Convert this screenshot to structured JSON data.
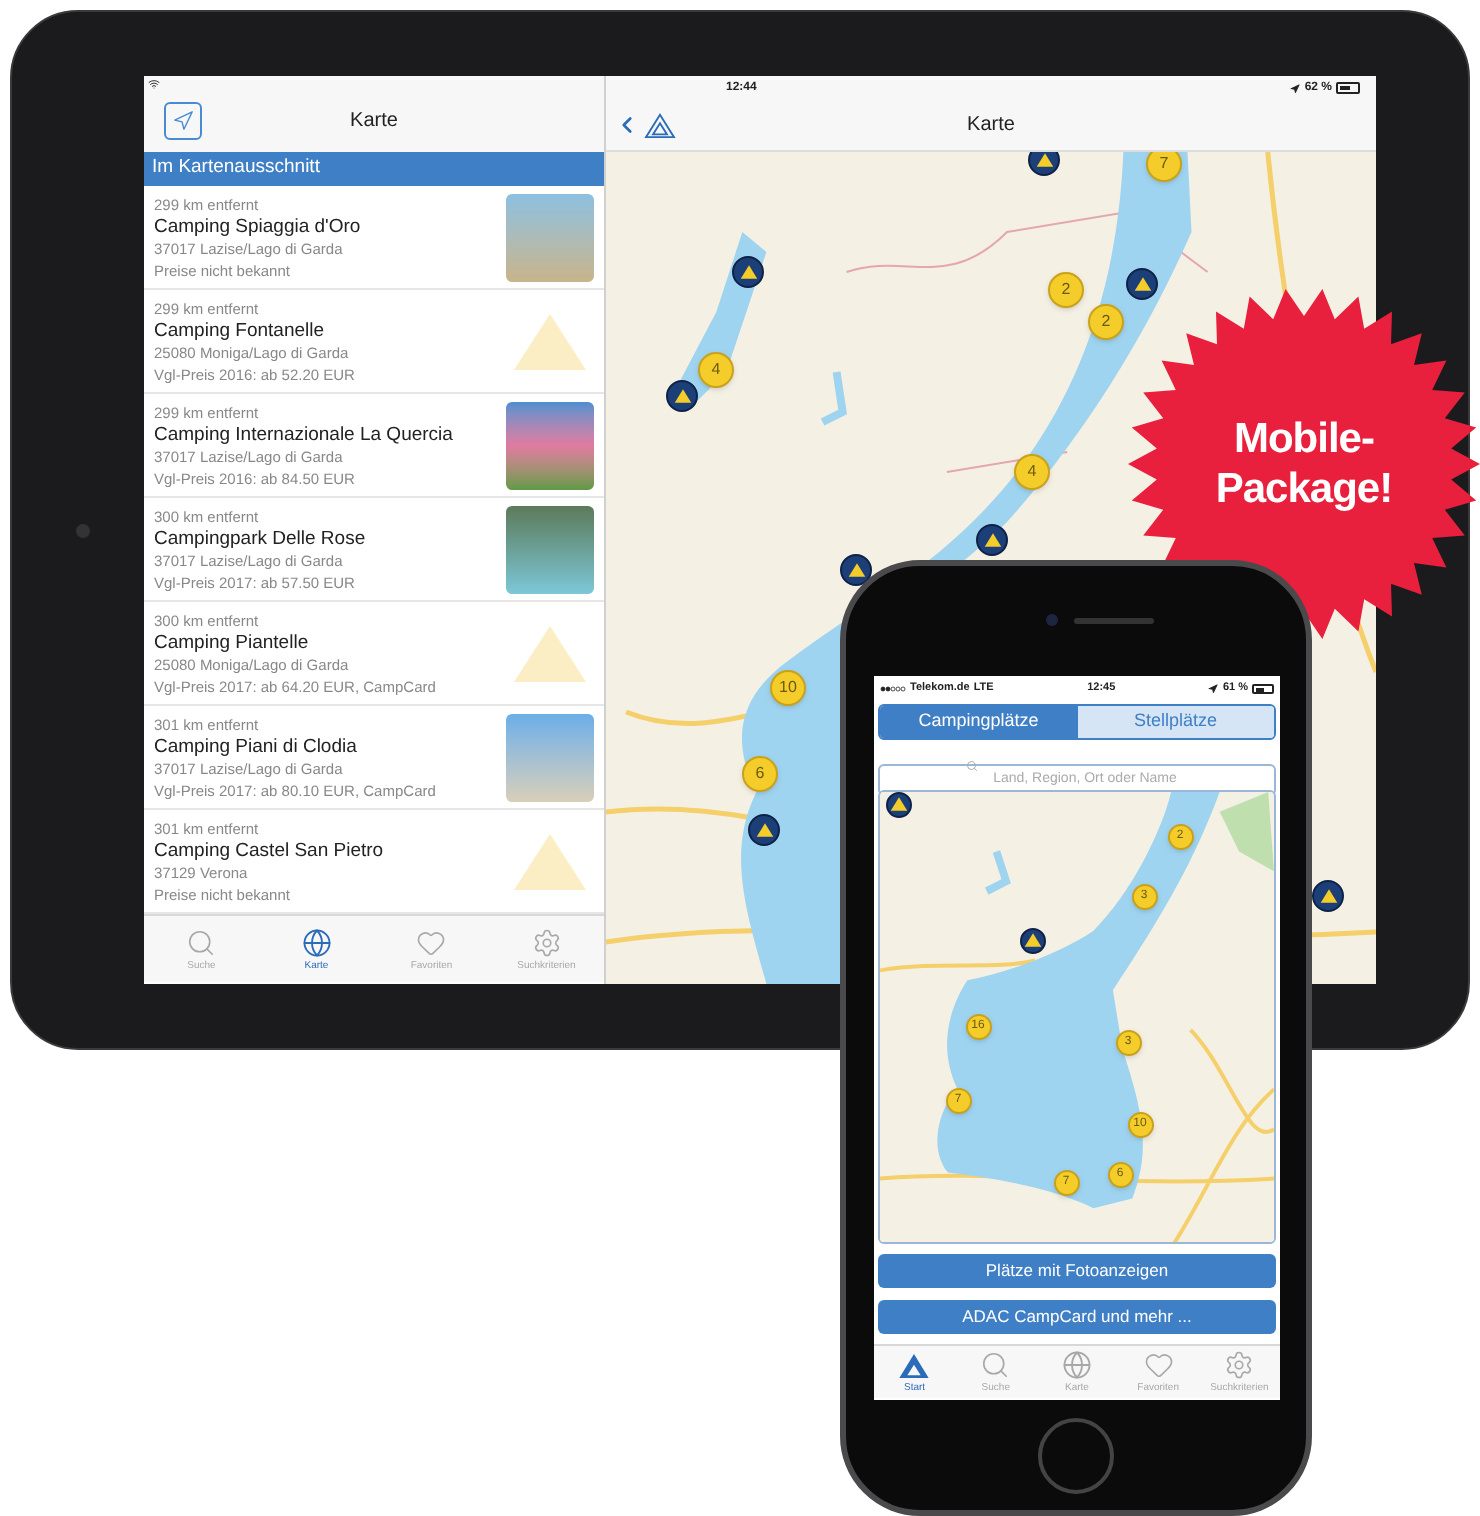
{
  "ipad": {
    "list_panel": {
      "title": "Karte",
      "section": "Im Kartenausschnitt",
      "items": [
        {
          "distance": "299 km entfernt",
          "name": "Camping Spiaggia d'Oro",
          "address": "37017 Lazise/Lago di Garda",
          "price": "Preise nicht bekannt",
          "kind": "photo"
        },
        {
          "distance": "299 km entfernt",
          "name": "Camping Fontanelle",
          "address": "25080 Moniga/Lago di Garda",
          "price": "Vgl-Preis 2016: ab 52.20 EUR",
          "kind": "logo"
        },
        {
          "distance": "299 km entfernt",
          "name": "Camping Internazionale La Quercia",
          "address": "37017 Lazise/Lago di Garda",
          "price": "Vgl-Preis 2016: ab 84.50 EUR",
          "kind": "photo"
        },
        {
          "distance": "300 km entfernt",
          "name": "Campingpark Delle Rose",
          "address": "37017 Lazise/Lago di Garda",
          "price": "Vgl-Preis 2017: ab 57.50 EUR",
          "kind": "photo"
        },
        {
          "distance": "300 km entfernt",
          "name": "Camping Piantelle",
          "address": "25080 Moniga/Lago di Garda",
          "price": "Vgl-Preis 2017: ab 64.20 EUR, CampCard",
          "kind": "logo"
        },
        {
          "distance": "301 km entfernt",
          "name": "Camping Piani di Clodia",
          "address": "37017 Lazise/Lago di Garda",
          "price": "Vgl-Preis 2017: ab 80.10 EUR, CampCard",
          "kind": "photo"
        },
        {
          "distance": "301 km entfernt",
          "name": "Camping Castel San Pietro",
          "address": "37129 Verona",
          "price": "Preise nicht bekannt",
          "kind": "logo"
        }
      ],
      "tabs": [
        {
          "label": "Suche",
          "selected": false
        },
        {
          "label": "Karte",
          "selected": true
        },
        {
          "label": "Favoriten",
          "selected": false
        },
        {
          "label": "Suchkriterien",
          "selected": false
        }
      ]
    },
    "map_panel": {
      "time": "12:44",
      "battery": "62 %",
      "title": "Karte",
      "clusters": [
        "7",
        "2",
        "2",
        "4",
        "4",
        "10",
        "6"
      ]
    }
  },
  "badge": {
    "lines": [
      "Mobile-",
      "Package!"
    ]
  },
  "iphone": {
    "carrier": "Telekom.de",
    "network": "LTE",
    "time": "12:45",
    "battery": "61 %",
    "segments": [
      {
        "label": "Campingplätze",
        "selected": true
      },
      {
        "label": "Stellplätze",
        "selected": false
      }
    ],
    "search": {
      "placeholder": "Land, Region, Ort oder Name"
    },
    "clusters": [
      "2",
      "3",
      "16",
      "3",
      "7",
      "10",
      "7",
      "6"
    ],
    "buttons": [
      "Plätze mit Fotoanzeigen",
      "ADAC CampCard und mehr ..."
    ],
    "tabs": [
      {
        "label": "Start",
        "selected": true
      },
      {
        "label": "Suche",
        "selected": false
      },
      {
        "label": "Karte",
        "selected": false
      },
      {
        "label": "Favoriten",
        "selected": false
      },
      {
        "label": "Suchkriterien",
        "selected": false
      }
    ]
  }
}
